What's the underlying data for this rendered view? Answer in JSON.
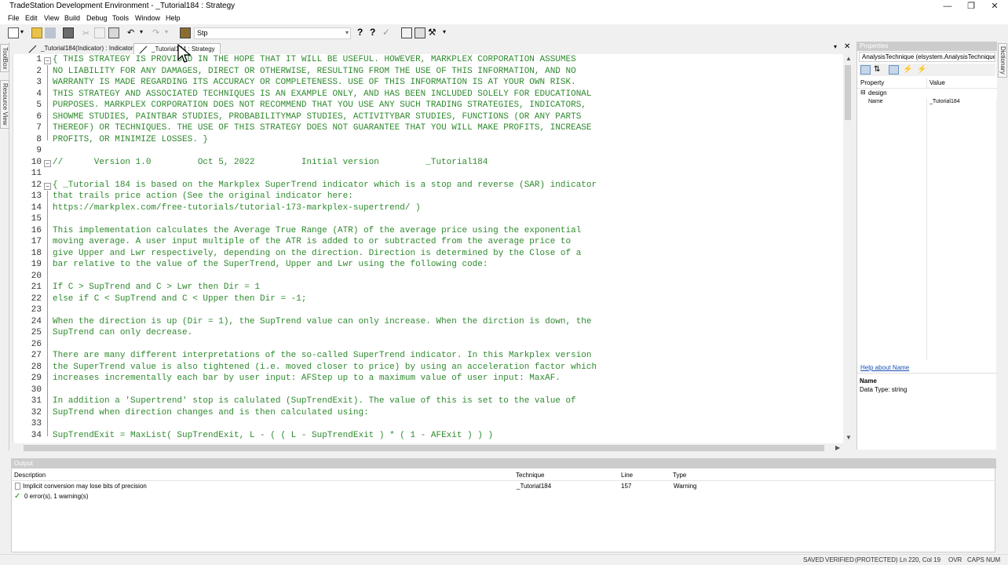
{
  "window": {
    "title": "TradeStation Development Environment - _Tutorial184 : Strategy"
  },
  "menu": [
    "File",
    "Edit",
    "View",
    "Build",
    "Debug",
    "Tools",
    "Window",
    "Help"
  ],
  "toolbar": {
    "combo_value": "Stp"
  },
  "left_panels": [
    "ToolBox",
    "Resource View"
  ],
  "tabs": [
    {
      "label": "_Tutorial184(Indicator) : Indicator",
      "active": false
    },
    {
      "label": "_Tutorial184 : Strategy",
      "active": true
    }
  ],
  "editor": {
    "lines": [
      {
        "n": "1",
        "text": "{ THIS STRATEGY IS PROVIDED IN THE HOPE THAT IT WILL BE USEFUL. HOWEVER, MARKPLEX CORPORATION ASSUMES"
      },
      {
        "n": "2",
        "text": "NO LIABILITY FOR ANY DAMAGES, DIRECT OR OTHERWISE, RESULTING FROM THE USE OF THIS INFORMATION, AND NO"
      },
      {
        "n": "3",
        "text": "WARRANTY IS MADE REGARDING ITS ACCURACY OR COMPLETENESS. USE OF THIS INFORMATION IS AT YOUR OWN RISK."
      },
      {
        "n": "4",
        "text": "THIS STRATEGY AND ASSOCIATED TECHNIQUES IS AN EXAMPLE ONLY, AND HAS BEEN INCLUDED SOLELY FOR EDUCATIONAL"
      },
      {
        "n": "5",
        "text": "PURPOSES. MARKPLEX CORPORATION DOES NOT RECOMMEND THAT YOU USE ANY SUCH TRADING STRATEGIES, INDICATORS,"
      },
      {
        "n": "6",
        "text": "SHOWME STUDIES, PAINTBAR STUDIES, PROBABILITYMAP STUDIES, ACTIVITYBAR STUDIES, FUNCTIONS (OR ANY PARTS"
      },
      {
        "n": "7",
        "text": "THEREOF) OR TECHNIQUES. THE USE OF THIS STRATEGY DOES NOT GUARANTEE THAT YOU WILL MAKE PROFITS, INCREASE"
      },
      {
        "n": "8",
        "text": "PROFITS, OR MINIMIZE LOSSES. }"
      },
      {
        "n": "9",
        "text": ""
      },
      {
        "n": "10",
        "text": "//      Version 1.0         Oct 5, 2022         Initial version         _Tutorial184"
      },
      {
        "n": "11",
        "text": ""
      },
      {
        "n": "12",
        "text": "{ _Tutorial 184 is based on the Markplex SuperTrend indicator which is a stop and reverse (SAR) indicator"
      },
      {
        "n": "13",
        "text": "that trails price action (See the original indicator here:"
      },
      {
        "n": "14",
        "text": "https://markplex.com/free-tutorials/tutorial-173-markplex-supertrend/ )"
      },
      {
        "n": "15",
        "text": ""
      },
      {
        "n": "16",
        "text": "This implementation calculates the Average True Range (ATR) of the average price using the exponential"
      },
      {
        "n": "17",
        "text": "moving average. A user input multiple of the ATR is added to or subtracted from the average price to"
      },
      {
        "n": "18",
        "text": "give Upper and Lwr respectively, depending on the direction. Direction is determined by the Close of a"
      },
      {
        "n": "19",
        "text": "bar relative to the value of the SuperTrend, Upper and Lwr using the following code:"
      },
      {
        "n": "20",
        "text": ""
      },
      {
        "n": "21",
        "text": "If C > SupTrend and C > Lwr then Dir = 1"
      },
      {
        "n": "22",
        "text": "else if C < SupTrend and C < Upper then Dir = -1;"
      },
      {
        "n": "23",
        "text": ""
      },
      {
        "n": "24",
        "text": "When the direction is up (Dir = 1), the SupTrend value can only increase. When the dirction is down, the"
      },
      {
        "n": "25",
        "text": "SupTrend can only decrease."
      },
      {
        "n": "26",
        "text": ""
      },
      {
        "n": "27",
        "text": "There are many different interpretations of the so-called SuperTrend indicator. In this Markplex version"
      },
      {
        "n": "28",
        "text": "the SuperTrend value is also tightened (i.e. moved closer to price) by using an acceleration factor which"
      },
      {
        "n": "29",
        "text": "increases incrementally each bar by user input: AFStep up to a maximum value of user input: MaxAF."
      },
      {
        "n": "30",
        "text": ""
      },
      {
        "n": "31",
        "text": "In addition a 'Supertrend' stop is calulated (SupTrendExit). The value of this is set to the value of"
      },
      {
        "n": "32",
        "text": "SupTrend when direction changes and is then calculated using:"
      },
      {
        "n": "33",
        "text": ""
      },
      {
        "n": "34",
        "text": "SupTrendExit = MaxList( SupTrendExit, L - ( ( L - SupTrendExit ) * ( 1 - AFExit ) ) )"
      }
    ]
  },
  "properties": {
    "title": "Properties",
    "selector": "AnalysisTechnique (elsystem.AnalysisTechnique",
    "col_property": "Property",
    "col_value": "Value",
    "category": "design",
    "row_name": "Name",
    "row_value": "_Tutorial184",
    "help_link": "Help about Name",
    "desc_name": "Name",
    "desc_type": "Data Type: string"
  },
  "right_panels": [
    "Dictionary"
  ],
  "output": {
    "title": "Output",
    "col_description": "Description",
    "col_technique": "Technique",
    "col_line": "Line",
    "col_type": "Type",
    "rows": [
      {
        "description": "Implicit conversion may lose bits of precision",
        "technique": "_Tutorial184",
        "line": "157",
        "type": "Warning"
      }
    ],
    "summary": "0 error(s), 1 warning(s)"
  },
  "status": {
    "saved": "SAVED",
    "verified": "VERIFIED",
    "protected": "(PROTECTED)",
    "position": "Ln 220, Col 19",
    "ovr": "OVR",
    "caps": "CAPS",
    "num": "NUM"
  },
  "colors": {
    "code_green": "#2f8a2f",
    "link_blue": "#1a4fb5",
    "panel_header": "#cccccc"
  }
}
